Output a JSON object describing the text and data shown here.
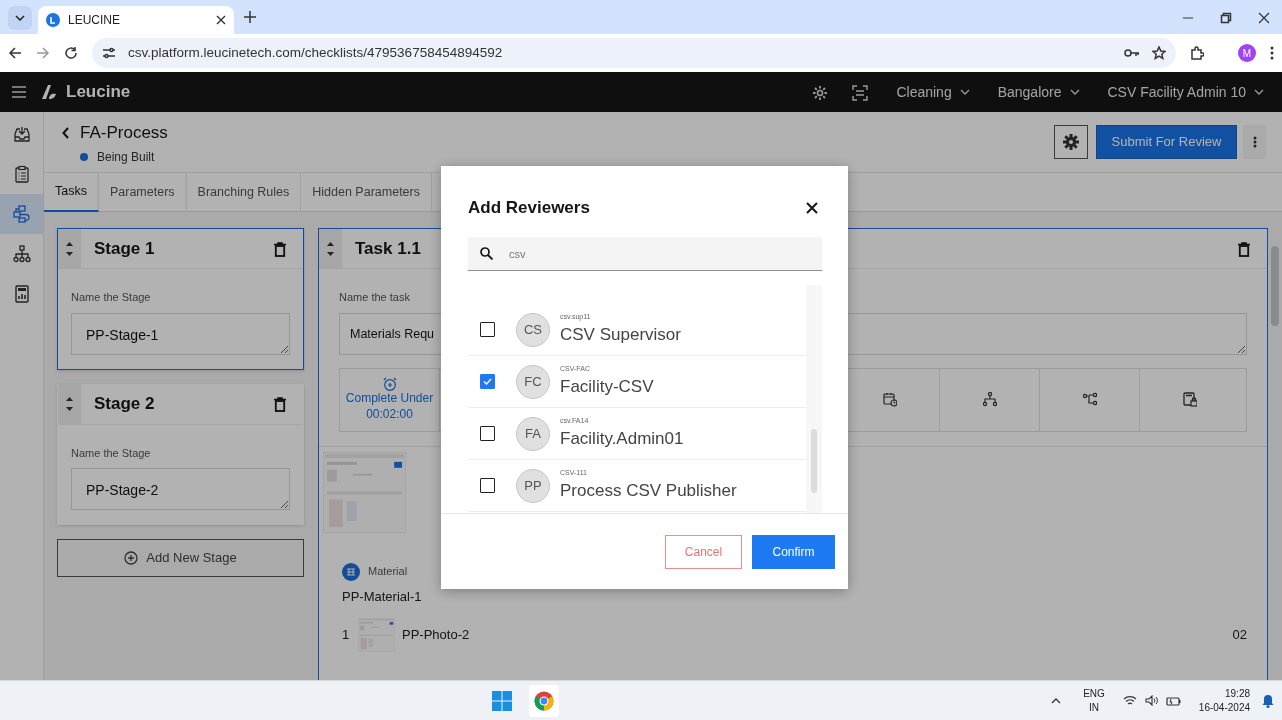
{
  "browser": {
    "tab_title": "LEUCINE",
    "url": "csv.platform.leucinetech.com/checklists/479536758454894592",
    "profile_initial": "M"
  },
  "app_header": {
    "brand": "Leucine",
    "menus": [
      {
        "label": "Cleaning"
      },
      {
        "label": "Bangalore"
      },
      {
        "label": "CSV Facility Admin 10"
      }
    ]
  },
  "sidebar": {
    "items": [
      {
        "selected": false
      },
      {
        "selected": false
      },
      {
        "selected": true
      },
      {
        "selected": false
      },
      {
        "selected": false
      }
    ]
  },
  "checklist": {
    "title": "FA-Process",
    "status": "Being Built",
    "submit": "Submit For Review"
  },
  "tabs": [
    {
      "label": "Tasks",
      "selected": true
    },
    {
      "label": "Parameters",
      "selected": false
    },
    {
      "label": "Branching Rules",
      "selected": false
    },
    {
      "label": "Hidden Parameters",
      "selected": false
    }
  ],
  "stages": [
    {
      "title": "Stage 1",
      "field_label": "Name the Stage",
      "value": "PP-Stage-1",
      "selected": true
    },
    {
      "title": "Stage 2",
      "field_label": "Name the Stage",
      "value": "PP-Stage-2",
      "selected": false
    }
  ],
  "add_stage": "Add New Stage",
  "task": {
    "title": "Task 1.1",
    "field_label": "Name the task",
    "value": "Materials Requ",
    "timer": {
      "label": "Complete Under",
      "value": "00:02:00"
    },
    "material": {
      "label": "Material",
      "name": "PP-Material-1",
      "rows": [
        {
          "index": "1",
          "name": "PP-Photo-2",
          "quantity": "02"
        }
      ]
    }
  },
  "modal": {
    "title": "Add Reviewers",
    "search": {
      "value": "csv"
    },
    "users": [
      {
        "initials": "CS",
        "username": "csv.sup11",
        "name": "CSV Supervisor",
        "checked": false
      },
      {
        "initials": "FC",
        "username": "CSV-FAC",
        "name": "Facility-CSV",
        "checked": true
      },
      {
        "initials": "FA",
        "username": "csv.FA14",
        "name": "Facility.Admin01",
        "checked": false
      },
      {
        "initials": "PP",
        "username": "CSV-111",
        "name": "Process CSV Publisher",
        "checked": false
      }
    ],
    "cancel": "Cancel",
    "confirm": "Confirm"
  },
  "taskbar": {
    "language": "ENG",
    "region": "IN",
    "time": "19:28",
    "date": "16-04-2024"
  }
}
